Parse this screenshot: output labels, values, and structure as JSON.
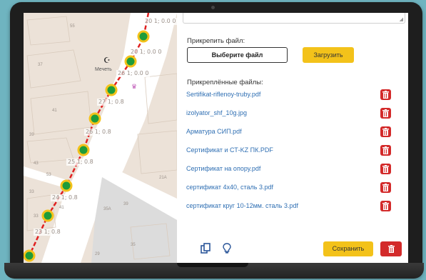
{
  "map": {
    "pin_labels": [
      "20 1; 0.0 0",
      "20 1; 0.0 0",
      "26 1; 0.0 0",
      "27 1; 0.8",
      "26 1; 0.8",
      "25 1; 0.8",
      "24 1; 0.8",
      "23 1; 0.8"
    ],
    "poi": {
      "name": "Мечеть",
      "icon": "mosque-icon"
    },
    "building_numbers": [
      "55",
      "37",
      "41",
      "39",
      "43",
      "53",
      "33",
      "41",
      "33",
      "35A",
      "39",
      "35",
      "29",
      "21A"
    ]
  },
  "panel": {
    "attach_label": "Прикрепить файл:",
    "choose_file_label": "Выберите файл",
    "upload_label": "Загрузить",
    "attached_label": "Прикреплённые файлы:",
    "files": [
      "Sertifikat-riflenoy-truby.pdf",
      "izolyator_shf_10g.jpg",
      "Арматура СИП.pdf",
      "Сертификат и СТ-KZ ПК.PDF",
      "Сертификат на опору.pdf",
      "сертификат 4х40, сталь 3.pdf",
      "сертификат круг 10-12мм. сталь 3.pdf"
    ],
    "save_label": "Сохранить",
    "icons": {
      "copy": "copy-icon",
      "bulb": "lightbulb-icon",
      "delete": "trash-icon"
    }
  },
  "colors": {
    "accent": "#f3c21a",
    "danger": "#d32a2a",
    "link": "#2f6fb3",
    "pin": "#1e9c3a",
    "route": "#e02020"
  }
}
